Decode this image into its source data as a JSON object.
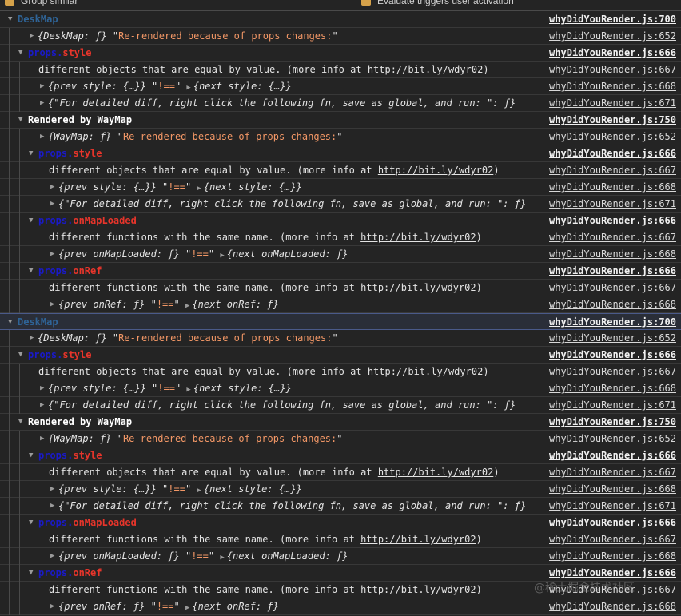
{
  "toolbar": {
    "group_similar": "Group similar",
    "evaluate_triggers": "Evaluate triggers user activation"
  },
  "watermark": "@稀土掘金技术社区",
  "colors": {
    "background": "#242424",
    "string": "#f29766",
    "props_prefix": "#1a1ac8",
    "prop_name": "#e8352b",
    "component": "#2f6497"
  },
  "rows": [
    {
      "kind": "group",
      "depth": 0,
      "segs": [
        [
          "DeskMap",
          "dm"
        ]
      ],
      "src": "whyDidYouRender.js:700",
      "bold": true
    },
    {
      "kind": "obj",
      "depth": 1,
      "segs": [
        [
          "{DeskMap: ƒ} ",
          "it"
        ],
        [
          "\"",
          "q"
        ],
        [
          "Re-rendered because of props changes:",
          "str"
        ],
        [
          "\"",
          "q"
        ]
      ],
      "src": "whyDidYouRender.js:652"
    },
    {
      "kind": "group",
      "depth": 1,
      "segs": [
        [
          "props.",
          "pp"
        ],
        [
          "style",
          "pn"
        ]
      ],
      "src": "whyDidYouRender.js:666",
      "bold": true
    },
    {
      "kind": "text",
      "depth": 2,
      "segs": [
        [
          "different objects that are equal by value. (more info at ",
          ""
        ],
        [
          "http://bit.ly/wdyr02",
          "lnk"
        ],
        [
          ")",
          ""
        ]
      ],
      "src": "whyDidYouRender.js:667"
    },
    {
      "kind": "obj",
      "depth": 2,
      "segs": [
        [
          "{prev style: {…}} ",
          "it"
        ],
        [
          "\"",
          "q"
        ],
        [
          "!==",
          "str"
        ],
        [
          "\" ",
          "q"
        ],
        [
          "▶",
          "itri"
        ],
        [
          "{next style: {…}}",
          "it"
        ]
      ],
      "src": "whyDidYouRender.js:668"
    },
    {
      "kind": "obj",
      "depth": 2,
      "segs": [
        [
          "{\"For detailed diff, right click the following fn, save as global, and run: \": ƒ}",
          "it"
        ]
      ],
      "src": "whyDidYouRender.js:671"
    },
    {
      "kind": "group",
      "depth": 1,
      "segs": [
        [
          "Rendered by WayMap",
          "bw"
        ]
      ],
      "src": "whyDidYouRender.js:750",
      "bold": true
    },
    {
      "kind": "obj",
      "depth": 2,
      "segs": [
        [
          "{WayMap: ƒ} ",
          "it"
        ],
        [
          "\"",
          "q"
        ],
        [
          "Re-rendered because of props changes:",
          "str"
        ],
        [
          "\"",
          "q"
        ]
      ],
      "src": "whyDidYouRender.js:652"
    },
    {
      "kind": "group",
      "depth": 2,
      "segs": [
        [
          "props.",
          "pp"
        ],
        [
          "style",
          "pn"
        ]
      ],
      "src": "whyDidYouRender.js:666",
      "bold": true
    },
    {
      "kind": "text",
      "depth": 3,
      "segs": [
        [
          "different objects that are equal by value. (more info at ",
          ""
        ],
        [
          "http://bit.ly/wdyr02",
          "lnk"
        ],
        [
          ")",
          ""
        ]
      ],
      "src": "whyDidYouRender.js:667"
    },
    {
      "kind": "obj",
      "depth": 3,
      "segs": [
        [
          "{prev style: {…}} ",
          "it"
        ],
        [
          "\"",
          "q"
        ],
        [
          "!==",
          "str"
        ],
        [
          "\" ",
          "q"
        ],
        [
          "▶",
          "itri"
        ],
        [
          "{next style: {…}}",
          "it"
        ]
      ],
      "src": "whyDidYouRender.js:668"
    },
    {
      "kind": "obj",
      "depth": 3,
      "segs": [
        [
          "{\"For detailed diff, right click the following fn, save as global, and run: \": ƒ}",
          "it"
        ]
      ],
      "src": "whyDidYouRender.js:671"
    },
    {
      "kind": "group",
      "depth": 2,
      "segs": [
        [
          "props.",
          "pp"
        ],
        [
          "onMapLoaded",
          "pn"
        ]
      ],
      "src": "whyDidYouRender.js:666",
      "bold": true
    },
    {
      "kind": "text",
      "depth": 3,
      "segs": [
        [
          "different functions with the same name. (more info at ",
          ""
        ],
        [
          "http://bit.ly/wdyr02",
          "lnk"
        ],
        [
          ")",
          ""
        ]
      ],
      "src": "whyDidYouRender.js:667"
    },
    {
      "kind": "obj",
      "depth": 3,
      "segs": [
        [
          "{prev onMapLoaded: ƒ} ",
          "it"
        ],
        [
          "\"",
          "q"
        ],
        [
          "!==",
          "str"
        ],
        [
          "\" ",
          "q"
        ],
        [
          "▶",
          "itri"
        ],
        [
          "{next onMapLoaded: ƒ}",
          "it"
        ]
      ],
      "src": "whyDidYouRender.js:668"
    },
    {
      "kind": "group",
      "depth": 2,
      "segs": [
        [
          "props.",
          "pp"
        ],
        [
          "onRef",
          "pn"
        ]
      ],
      "src": "whyDidYouRender.js:666",
      "bold": true
    },
    {
      "kind": "text",
      "depth": 3,
      "segs": [
        [
          "different functions with the same name. (more info at ",
          ""
        ],
        [
          "http://bit.ly/wdyr02",
          "lnk"
        ],
        [
          ")",
          ""
        ]
      ],
      "src": "whyDidYouRender.js:667"
    },
    {
      "kind": "obj",
      "depth": 3,
      "segs": [
        [
          "{prev onRef: ƒ} ",
          "it"
        ],
        [
          "\"",
          "q"
        ],
        [
          "!==",
          "str"
        ],
        [
          "\" ",
          "q"
        ],
        [
          "▶",
          "itri"
        ],
        [
          "{next onRef: ƒ}",
          "it"
        ]
      ],
      "src": "whyDidYouRender.js:668"
    },
    {
      "kind": "group",
      "depth": 0,
      "segs": [
        [
          "DeskMap",
          "dm"
        ]
      ],
      "src": "whyDidYouRender.js:700",
      "bold": true,
      "highlight": true
    },
    {
      "kind": "obj",
      "depth": 1,
      "segs": [
        [
          "{DeskMap: ƒ} ",
          "it"
        ],
        [
          "\"",
          "q"
        ],
        [
          "Re-rendered because of props changes:",
          "str"
        ],
        [
          "\"",
          "q"
        ]
      ],
      "src": "whyDidYouRender.js:652"
    },
    {
      "kind": "group",
      "depth": 1,
      "segs": [
        [
          "props.",
          "pp"
        ],
        [
          "style",
          "pn"
        ]
      ],
      "src": "whyDidYouRender.js:666",
      "bold": true
    },
    {
      "kind": "text",
      "depth": 2,
      "segs": [
        [
          "different objects that are equal by value. (more info at ",
          ""
        ],
        [
          "http://bit.ly/wdyr02",
          "lnk"
        ],
        [
          ")",
          ""
        ]
      ],
      "src": "whyDidYouRender.js:667"
    },
    {
      "kind": "obj",
      "depth": 2,
      "segs": [
        [
          "{prev style: {…}} ",
          "it"
        ],
        [
          "\"",
          "q"
        ],
        [
          "!==",
          "str"
        ],
        [
          "\" ",
          "q"
        ],
        [
          "▶",
          "itri"
        ],
        [
          "{next style: {…}}",
          "it"
        ]
      ],
      "src": "whyDidYouRender.js:668"
    },
    {
      "kind": "obj",
      "depth": 2,
      "segs": [
        [
          "{\"For detailed diff, right click the following fn, save as global, and run: \": ƒ}",
          "it"
        ]
      ],
      "src": "whyDidYouRender.js:671"
    },
    {
      "kind": "group",
      "depth": 1,
      "segs": [
        [
          "Rendered by WayMap",
          "bw"
        ]
      ],
      "src": "whyDidYouRender.js:750",
      "bold": true
    },
    {
      "kind": "obj",
      "depth": 2,
      "segs": [
        [
          "{WayMap: ƒ} ",
          "it"
        ],
        [
          "\"",
          "q"
        ],
        [
          "Re-rendered because of props changes:",
          "str"
        ],
        [
          "\"",
          "q"
        ]
      ],
      "src": "whyDidYouRender.js:652"
    },
    {
      "kind": "group",
      "depth": 2,
      "segs": [
        [
          "props.",
          "pp"
        ],
        [
          "style",
          "pn"
        ]
      ],
      "src": "whyDidYouRender.js:666",
      "bold": true
    },
    {
      "kind": "text",
      "depth": 3,
      "segs": [
        [
          "different objects that are equal by value. (more info at ",
          ""
        ],
        [
          "http://bit.ly/wdyr02",
          "lnk"
        ],
        [
          ")",
          ""
        ]
      ],
      "src": "whyDidYouRender.js:667"
    },
    {
      "kind": "obj",
      "depth": 3,
      "segs": [
        [
          "{prev style: {…}} ",
          "it"
        ],
        [
          "\"",
          "q"
        ],
        [
          "!==",
          "str"
        ],
        [
          "\" ",
          "q"
        ],
        [
          "▶",
          "itri"
        ],
        [
          "{next style: {…}}",
          "it"
        ]
      ],
      "src": "whyDidYouRender.js:668"
    },
    {
      "kind": "obj",
      "depth": 3,
      "segs": [
        [
          "{\"For detailed diff, right click the following fn, save as global, and run: \": ƒ}",
          "it"
        ]
      ],
      "src": "whyDidYouRender.js:671"
    },
    {
      "kind": "group",
      "depth": 2,
      "segs": [
        [
          "props.",
          "pp"
        ],
        [
          "onMapLoaded",
          "pn"
        ]
      ],
      "src": "whyDidYouRender.js:666",
      "bold": true
    },
    {
      "kind": "text",
      "depth": 3,
      "segs": [
        [
          "different functions with the same name. (more info at ",
          ""
        ],
        [
          "http://bit.ly/wdyr02",
          "lnk"
        ],
        [
          ")",
          ""
        ]
      ],
      "src": "whyDidYouRender.js:667"
    },
    {
      "kind": "obj",
      "depth": 3,
      "segs": [
        [
          "{prev onMapLoaded: ƒ} ",
          "it"
        ],
        [
          "\"",
          "q"
        ],
        [
          "!==",
          "str"
        ],
        [
          "\" ",
          "q"
        ],
        [
          "▶",
          "itri"
        ],
        [
          "{next onMapLoaded: ƒ}",
          "it"
        ]
      ],
      "src": "whyDidYouRender.js:668"
    },
    {
      "kind": "group",
      "depth": 2,
      "segs": [
        [
          "props.",
          "pp"
        ],
        [
          "onRef",
          "pn"
        ]
      ],
      "src": "whyDidYouRender.js:666",
      "bold": true
    },
    {
      "kind": "text",
      "depth": 3,
      "segs": [
        [
          "different functions with the same name. (more info at ",
          ""
        ],
        [
          "http://bit.ly/wdyr02",
          "lnk"
        ],
        [
          ")",
          ""
        ]
      ],
      "src": "whyDidYouRender.js:667"
    },
    {
      "kind": "obj",
      "depth": 3,
      "segs": [
        [
          "{prev onRef: ƒ} ",
          "it"
        ],
        [
          "\"",
          "q"
        ],
        [
          "!==",
          "str"
        ],
        [
          "\" ",
          "q"
        ],
        [
          "▶",
          "itri"
        ],
        [
          "{next onRef: ƒ}",
          "it"
        ]
      ],
      "src": "whyDidYouRender.js:668"
    }
  ]
}
